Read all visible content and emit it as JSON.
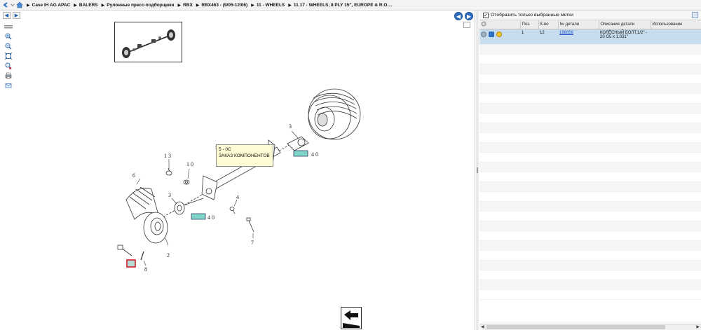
{
  "breadcrumb": {
    "items": [
      "Case IH AG APAC",
      "BALERS",
      "Рулонные пресс-подборщики",
      "RBX",
      "RBX463 - (9/05-12/06)",
      "11 - WHEELS",
      "11.17 - WHEELS, 8 PLY 15\", EUROPE & R.O...."
    ]
  },
  "toolbar": {
    "back_icon": "back-arrow-icon",
    "forward_icon": "forward-arrow-icon",
    "prev_icon": "circle-left-arrow-icon",
    "next_icon": "circle-right-arrow-icon"
  },
  "tools": [
    "zoom-in-icon",
    "zoom-out-icon",
    "fit-icon",
    "reset-zoom-icon",
    "print-icon",
    "email-icon"
  ],
  "diagram": {
    "callouts": [
      {
        "label": "1 3"
      },
      {
        "label": "1 0"
      },
      {
        "label": "6"
      },
      {
        "label": "5"
      },
      {
        "label": "3"
      },
      {
        "label": "3"
      },
      {
        "label": "4 0"
      },
      {
        "label": "4 0"
      },
      {
        "label": "4"
      },
      {
        "label": "2"
      },
      {
        "label": "7"
      },
      {
        "label": "8"
      }
    ],
    "tooltip": {
      "line1": "5 - 0C",
      "line2": "ЗАКАЗ КОМПОНЕНТОВ"
    }
  },
  "right_panel": {
    "filter_label": "Отобразить только выбранные метки",
    "filter_checked": "✓",
    "columns": [
      "",
      "Поз.",
      "К-во",
      "№ детали",
      "Описание детали",
      "Использование"
    ],
    "rows": [
      {
        "pos": "1",
        "qty": "12",
        "part_no": "198856",
        "description": "КОЛЁСНЫЙ БОЛТ,1/2\" - 20 G5 x 1.031\"",
        "usage": ""
      }
    ]
  },
  "colors": {
    "accent": "#2e6ec0",
    "selected_row": "#c7dcec",
    "highlight_red": "#d0202a",
    "teal_box": "#7fd6c8"
  }
}
